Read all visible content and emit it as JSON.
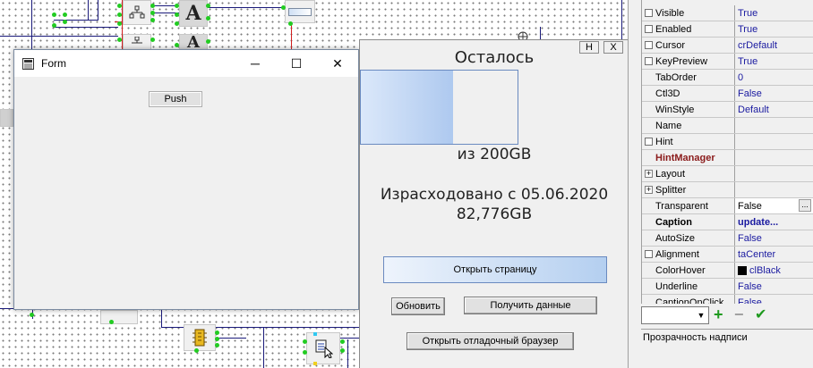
{
  "canvas": {
    "component_letter": "A"
  },
  "form_window": {
    "title": "Form",
    "push_label": "Push",
    "minimize_glyph": "─",
    "maximize_glyph": "☐",
    "close_glyph": "✕"
  },
  "app_window": {
    "sys_btn_left": "H",
    "sys_btn_right": "X",
    "remaining_label": "Осталось",
    "total_label": "из 200GB",
    "used_label": "Израсходовано с 05.06.2020",
    "used_value": "82,776GB",
    "open_page_button": "Открыть страницу",
    "refresh_button": "Обновить",
    "get_data_button": "Получить данные",
    "debug_browser_button": "Открыть отладочный браузер",
    "remaining_fraction": 0.586
  },
  "inspector": {
    "properties": [
      {
        "name": "Visible",
        "value": "True",
        "marker": "check"
      },
      {
        "name": "Enabled",
        "value": "True",
        "marker": "check"
      },
      {
        "name": "Cursor",
        "value": "crDefault",
        "marker": "check"
      },
      {
        "name": "KeyPreview",
        "value": "True",
        "marker": "check"
      },
      {
        "name": "TabOrder",
        "value": "0",
        "marker": ""
      },
      {
        "name": "Ctl3D",
        "value": "False",
        "marker": ""
      },
      {
        "name": "WinStyle",
        "value": "Default",
        "marker": ""
      },
      {
        "name": "Name",
        "value": "",
        "marker": ""
      },
      {
        "name": "Hint",
        "value": "",
        "marker": "check"
      },
      {
        "name": "HintManager",
        "value": "",
        "marker": "",
        "style": "hint"
      },
      {
        "name": "Layout",
        "value": "",
        "marker": "expand"
      },
      {
        "name": "Splitter",
        "value": "",
        "marker": "expand"
      },
      {
        "name": "Transparent",
        "value": "False",
        "marker": "",
        "style": "edit"
      },
      {
        "name": "Caption",
        "value": "update...",
        "marker": "",
        "style": "bold"
      },
      {
        "name": "AutoSize",
        "value": "False",
        "marker": ""
      },
      {
        "name": "Alignment",
        "value": "taCenter",
        "marker": "check"
      },
      {
        "name": "ColorHover",
        "value": "clBlack",
        "marker": "",
        "style": "swatch"
      },
      {
        "name": "Underline",
        "value": "False",
        "marker": ""
      },
      {
        "name": "CaptionOnClick",
        "value": "False",
        "marker": ""
      }
    ],
    "expand_glyph": "+",
    "ellipsis_glyph": "...",
    "combo_arrow": "▼",
    "add_icon": "+",
    "remove_icon": "−",
    "apply_icon": "✔",
    "hint_text": "Прозрачность надписи",
    "colors": {
      "value_blue": "#1a1aa0",
      "add_green": "#1f9a1f",
      "apply_green": "#1f9a1f"
    }
  }
}
